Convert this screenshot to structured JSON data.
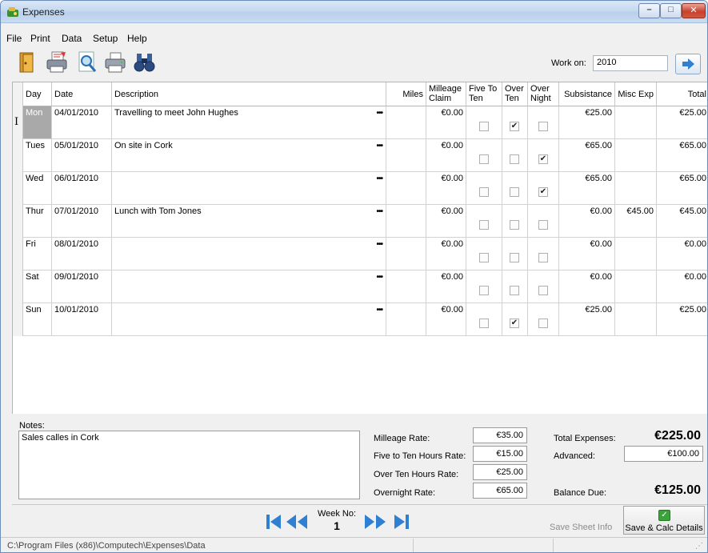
{
  "window": {
    "title": "Expenses"
  },
  "menu": {
    "items": [
      "File",
      "Print",
      "Data",
      "Setup",
      "Help"
    ]
  },
  "toolbar": {
    "icons": [
      "exit-door-icon",
      "print-options-icon",
      "print-preview-icon",
      "printer-icon",
      "binoculars-find-icon"
    ],
    "work_on_label": "Work on:",
    "work_on_value": "2010",
    "go_icon": "arrow-right-icon"
  },
  "grid": {
    "columns": [
      "Day",
      "Date",
      "Description",
      "Miles",
      "Milleage Claim",
      "Five To Ten",
      "Over Ten",
      "Over Night",
      "Subsistance",
      "Misc Exp",
      "Total"
    ],
    "column_lines": {
      "Milleage Claim": [
        "Milleage",
        "Claim"
      ],
      "Five To Ten": [
        "Five To",
        "Ten"
      ],
      "Over Ten": [
        "Over",
        "Ten"
      ],
      "Over Night": [
        "Over",
        "Night"
      ]
    },
    "rows": [
      {
        "day": "Mon",
        "date": "04/01/2010",
        "description": "Travelling to meet John Hughes",
        "miles": "",
        "claim": "€0.00",
        "five_to_ten": false,
        "over_ten": true,
        "over_night": false,
        "subsistance": "€25.00",
        "misc": "",
        "total": "€25.00"
      },
      {
        "day": "Tues",
        "date": "05/01/2010",
        "description": "On site in Cork",
        "miles": "",
        "claim": "€0.00",
        "five_to_ten": false,
        "over_ten": false,
        "over_night": true,
        "subsistance": "€65.00",
        "misc": "",
        "total": "€65.00"
      },
      {
        "day": "Wed",
        "date": "06/01/2010",
        "description": "",
        "miles": "",
        "claim": "€0.00",
        "five_to_ten": false,
        "over_ten": false,
        "over_night": true,
        "subsistance": "€65.00",
        "misc": "",
        "total": "€65.00"
      },
      {
        "day": "Thur",
        "date": "07/01/2010",
        "description": "Lunch with Tom Jones",
        "miles": "",
        "claim": "€0.00",
        "five_to_ten": false,
        "over_ten": false,
        "over_night": false,
        "subsistance": "€0.00",
        "misc": "€45.00",
        "total": "€45.00"
      },
      {
        "day": "Fri",
        "date": "08/01/2010",
        "description": "",
        "miles": "",
        "claim": "€0.00",
        "five_to_ten": false,
        "over_ten": false,
        "over_night": false,
        "subsistance": "€0.00",
        "misc": "",
        "total": "€0.00"
      },
      {
        "day": "Sat",
        "date": "09/01/2010",
        "description": "",
        "miles": "",
        "claim": "€0.00",
        "five_to_ten": false,
        "over_ten": false,
        "over_night": false,
        "subsistance": "€0.00",
        "misc": "",
        "total": "€0.00"
      },
      {
        "day": "Sun",
        "date": "10/01/2010",
        "description": "",
        "miles": "",
        "claim": "€0.00",
        "five_to_ten": false,
        "over_ten": true,
        "over_night": false,
        "subsistance": "€25.00",
        "misc": "",
        "total": "€25.00"
      }
    ],
    "selected_row": 0
  },
  "notes": {
    "label": "Notes:",
    "value": "Sales calles in Cork"
  },
  "rates": {
    "mileage": {
      "label": "Milleage Rate:",
      "value": "€35.00"
    },
    "five_to_ten": {
      "label": "Five to Ten Hours Rate:",
      "value": "€15.00"
    },
    "over_ten": {
      "label": "Over Ten Hours Rate:",
      "value": "€25.00"
    },
    "overnight": {
      "label": "Overnight Rate:",
      "value": "€65.00"
    }
  },
  "totals": {
    "total_label": "Total Expenses:",
    "total_value": "€225.00",
    "advanced_label": "Advanced:",
    "advanced_value": "€100.00",
    "balance_label": "Balance Due:",
    "balance_value": "€125.00"
  },
  "nav": {
    "week_label": "Week No:",
    "week_value": "1",
    "icons": [
      "first-week-icon",
      "previous-week-icon",
      "next-week-icon",
      "last-week-icon"
    ]
  },
  "actions": {
    "save_sheet": "Save Sheet Info",
    "save_calc": "Save & Calc Details"
  },
  "status": {
    "path": "C:\\Program Files (x86)\\Computech\\Expenses\\Data"
  },
  "colors": {
    "nav_blue": "#2f7fd3",
    "selected_day_bg": "#a9a9a9",
    "titlebar": "#c6d9f0"
  }
}
